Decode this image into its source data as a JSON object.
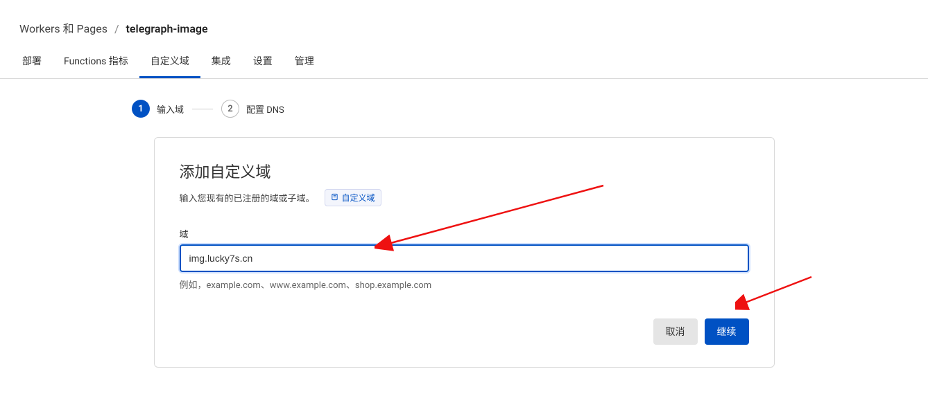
{
  "breadcrumb": {
    "parent": "Workers 和 Pages",
    "separator": "/",
    "current": "telegraph-image"
  },
  "tabs": [
    {
      "label": "部署",
      "active": false
    },
    {
      "label": "Functions 指标",
      "active": false
    },
    {
      "label": "自定义域",
      "active": true
    },
    {
      "label": "集成",
      "active": false
    },
    {
      "label": "设置",
      "active": false
    },
    {
      "label": "管理",
      "active": false
    }
  ],
  "stepper": {
    "steps": [
      {
        "number": "1",
        "label": "输入域",
        "active": true
      },
      {
        "number": "2",
        "label": "配置 DNS",
        "active": false
      }
    ]
  },
  "card": {
    "title": "添加自定义域",
    "subtitle": "输入您现有的已注册的域或子域。",
    "doc_link_label": "自定义域",
    "field_label": "域",
    "domain_value": "img.lucky7s.cn",
    "hint": "例如，example.com、www.example.com、shop.example.com",
    "cancel_label": "取消",
    "continue_label": "继续"
  }
}
